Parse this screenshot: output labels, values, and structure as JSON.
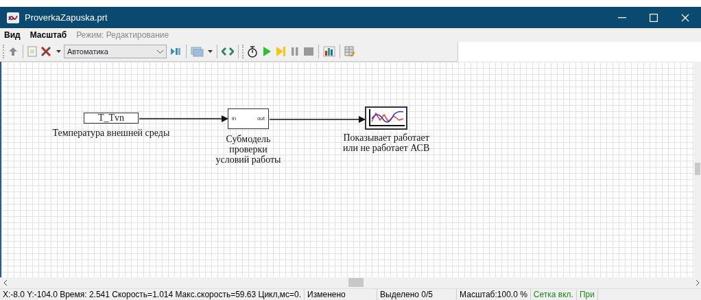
{
  "window": {
    "title": "ProverkaZapuska.prt"
  },
  "menu": [
    {
      "label": "Вид",
      "disabled": false
    },
    {
      "label": "Масштаб",
      "disabled": false
    },
    {
      "label": "Режим: Редактирование",
      "disabled": true
    }
  ],
  "toolbar": {
    "combo_value": "Автоматика"
  },
  "diagram": {
    "blocks": [
      {
        "kind": "constant",
        "text": "T_Tvn",
        "caption": [
          "Температура внешней среды"
        ]
      },
      {
        "kind": "submodel",
        "in": "in",
        "out": "out",
        "caption": [
          "Субмодель",
          "проверки",
          "условий работы"
        ]
      },
      {
        "kind": "scope",
        "caption": [
          "Показывает работает",
          "или не работает АСВ"
        ]
      }
    ]
  },
  "status_bar": [
    {
      "text": "X:-8.0  Y:-104.0 Время: 2.541 Скорость=1.014 Макс.скорость=59.63 Цикл,мс=0.",
      "color": "#000000"
    },
    {
      "text": "Изменено",
      "color": "#000000"
    },
    {
      "text": "Выделено 0/5",
      "color": "#000000"
    },
    {
      "text": "Масштаб:100.0 %",
      "color": "#000000"
    },
    {
      "text": "Сетка вкл.",
      "color": "#1a8a1a"
    },
    {
      "text": "При",
      "color": "#1a8a1a"
    }
  ]
}
